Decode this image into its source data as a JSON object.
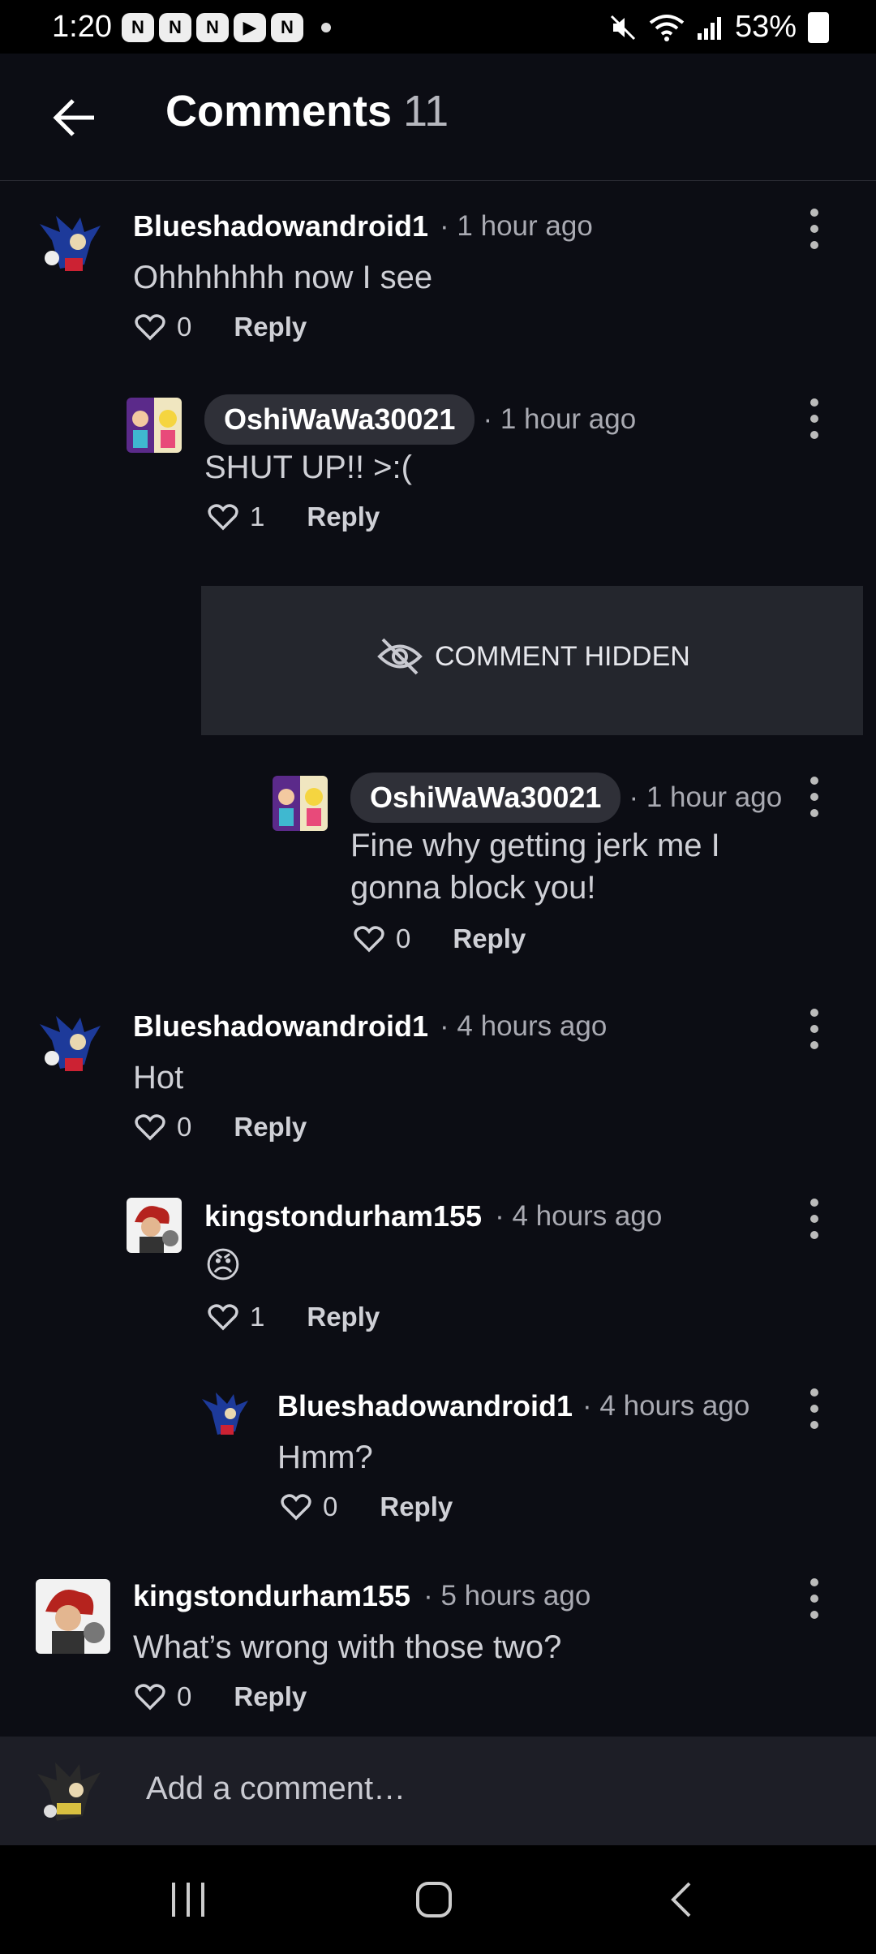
{
  "status_bar": {
    "time": "1:20",
    "battery": "53%",
    "apps": [
      "N",
      "N",
      "N",
      "▶",
      "N"
    ]
  },
  "header": {
    "title": "Comments",
    "count": "11"
  },
  "hidden_notice": "COMMENT HIDDEN",
  "comments": [
    {
      "username": "Blueshadowandroid1",
      "time": "· 1 hour ago",
      "text": "Ohhhhhhh now I see",
      "likes": "0",
      "reply": "Reply"
    },
    {
      "username": "OshiWaWa30021",
      "time": "· 1 hour ago",
      "text": "SHUT UP!! >:(",
      "likes": "1",
      "reply": "Reply"
    },
    {
      "username": "OshiWaWa30021",
      "time": "· 1 hour ago",
      "text": "Fine why getting jerk me I gonna block you!",
      "likes": "0",
      "reply": "Reply"
    },
    {
      "username": "Blueshadowandroid1",
      "time": "· 4 hours ago",
      "text": "Hot",
      "likes": "0",
      "reply": "Reply"
    },
    {
      "username": "kingstondurham155",
      "time": "· 4 hours ago",
      "text": "😠",
      "likes": "1",
      "reply": "Reply"
    },
    {
      "username": "Blueshadowandroid1",
      "time": "· 4 hours ago",
      "text": "Hmm?",
      "likes": "0",
      "reply": "Reply"
    },
    {
      "username": "kingstondurham155",
      "time": "· 5 hours ago",
      "text": "What’s wrong with those two?",
      "likes": "0",
      "reply": "Reply"
    }
  ],
  "add_comment": {
    "placeholder": "Add a comment…"
  },
  "colors": {
    "background": "#0c0d14",
    "pill": "#2f3038",
    "hidden_card": "#24262d",
    "muted_text": "#a9aab2"
  }
}
